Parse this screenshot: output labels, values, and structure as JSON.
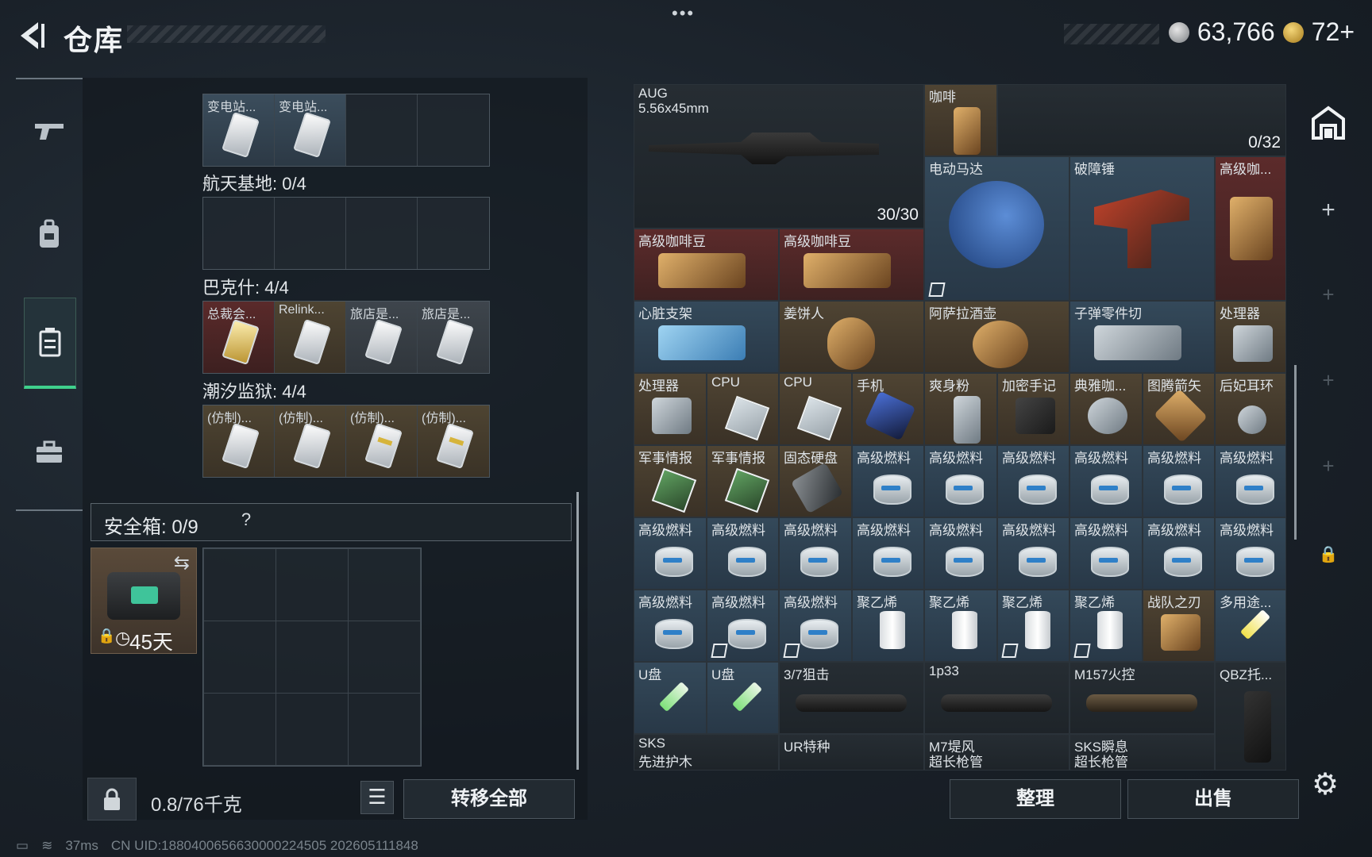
{
  "header": {
    "title": "仓库",
    "menu": "•••",
    "currency": [
      {
        "icon": "silver-coin-icon",
        "value": "63,766"
      },
      {
        "icon": "gold-triangle-coin-icon",
        "value": "72+"
      }
    ]
  },
  "nav": [
    {
      "name": "weapon",
      "icon": "gun-icon"
    },
    {
      "name": "backpack",
      "icon": "backpack-icon"
    },
    {
      "name": "container",
      "icon": "container-icon",
      "active": true
    },
    {
      "name": "briefcase",
      "icon": "briefcase-icon"
    }
  ],
  "collections": {
    "top_items": [
      "变电站...",
      "变电站..."
    ],
    "sections": [
      {
        "label": "航天基地: 0/4",
        "items": []
      },
      {
        "label": "巴克什: 4/4",
        "items": [
          "总裁会...",
          "Relink...",
          "旅店是...",
          "旅店是..."
        ]
      },
      {
        "label": "潮汐监狱: 4/4",
        "items": [
          "(仿制)...",
          "(仿制)...",
          "(仿制)...",
          "(仿制)..."
        ]
      }
    ]
  },
  "safebox": {
    "label": "安全箱: 0/9",
    "help": "?",
    "days": "45天"
  },
  "bottom_left": {
    "weight": "0.8/76千克",
    "transfer_all": "转移全部"
  },
  "warehouse": {
    "aug": {
      "name": "AUG",
      "ammo": "5.56x45mm",
      "count": "30/30"
    },
    "coffee": "咖啡",
    "top_right_count": "0/32",
    "row2": [
      "电动马达",
      "破障锤",
      "高级咖..."
    ],
    "row3": [
      "高级咖啡豆",
      "高级咖啡豆"
    ],
    "row4": [
      "心脏支架",
      "姜饼人",
      "阿萨拉酒壶",
      "子弹零件切",
      "处理器"
    ],
    "row5": [
      "处理器",
      "CPU",
      "CPU",
      "手机",
      "爽身粉",
      "加密手记",
      "典雅咖...",
      "图腾箭矢",
      "后妃耳环"
    ],
    "row6": [
      "军事情报",
      "军事情报",
      "固态硬盘",
      "高级燃料",
      "高级燃料",
      "高级燃料",
      "高级燃料",
      "高级燃料",
      "高级燃料"
    ],
    "row7": [
      "高级燃料",
      "高级燃料",
      "高级燃料",
      "高级燃料",
      "高级燃料",
      "高级燃料",
      "高级燃料",
      "高级燃料",
      "高级燃料"
    ],
    "row8": [
      "高级燃料",
      "高级燃料",
      "高级燃料",
      "聚乙烯",
      "聚乙烯",
      "聚乙烯",
      "聚乙烯",
      "战队之刃",
      "多用途..."
    ],
    "row9": [
      "U盘",
      "U盘",
      "3/7狙击",
      "1p33",
      "M157火控",
      "QBZ托..."
    ],
    "row10": [
      {
        "name": "SKS",
        "sub": "先进护木"
      },
      {
        "name": "UR特种",
        "sub": ""
      },
      {
        "name": "M7堤风",
        "sub": "超长枪管"
      },
      {
        "name": "SKS瞬息",
        "sub": "超长枪管"
      }
    ]
  },
  "actions": {
    "sort": "整理",
    "sell": "出售"
  },
  "status": {
    "ping": "37ms",
    "uid": "CN UID:1880400656630000224505 202605111848"
  }
}
